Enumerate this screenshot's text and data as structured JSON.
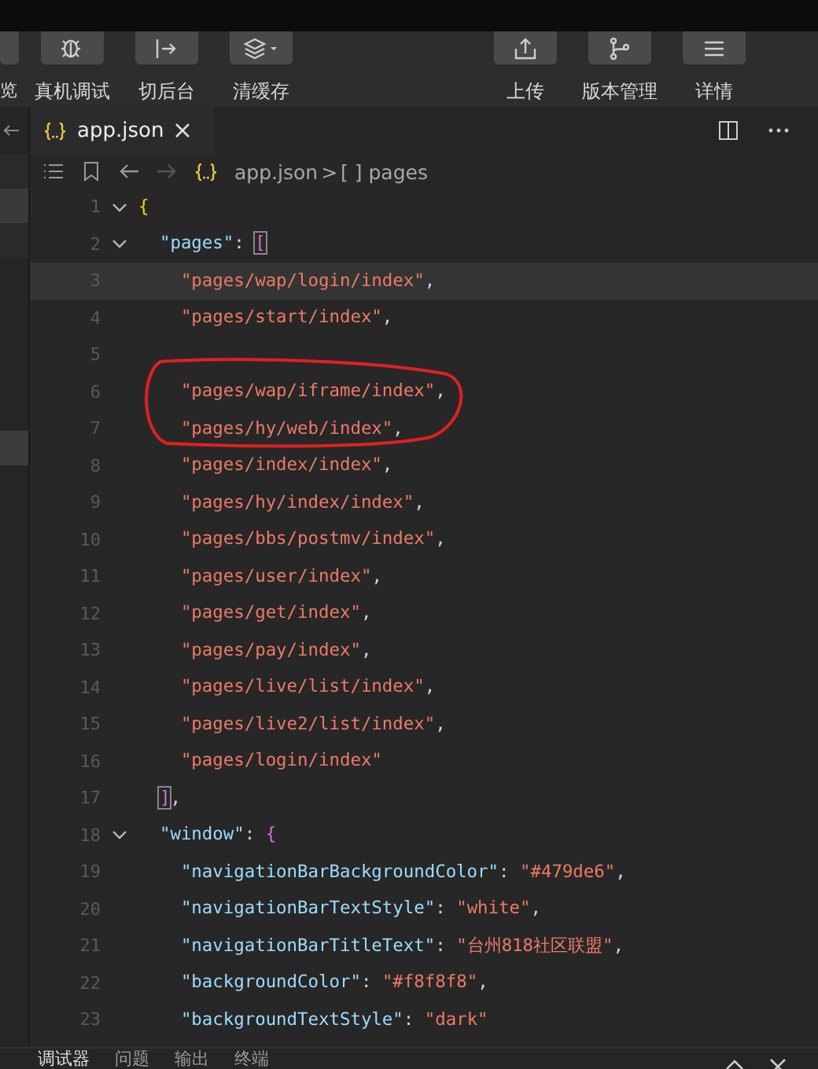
{
  "toolbar": {
    "left_buttons": [
      {
        "kind": "partial",
        "label": "览"
      },
      {
        "kind": "bug",
        "label": "真机调试"
      },
      {
        "kind": "exit",
        "label": "切后台"
      },
      {
        "kind": "layers",
        "label": "清缓存"
      }
    ],
    "right_buttons": [
      {
        "kind": "upload",
        "label": "上传"
      },
      {
        "kind": "branch",
        "label": "版本管理"
      },
      {
        "kind": "menu",
        "label": "详情"
      }
    ]
  },
  "tabs": [
    {
      "label": "app.json",
      "selected": true
    }
  ],
  "breadcrumb": {
    "file": "app.json",
    "separator": ">",
    "symbol": "[ ] pages"
  },
  "code_lines": [
    {
      "number": "1",
      "fold": true,
      "tokens": [
        {
          "kind": "brace1",
          "text": "{"
        }
      ],
      "children": [
        {
          "number": "2",
          "fold": true,
          "tokens": [
            {
              "kind": "key",
              "text": "\"pages\""
            },
            {
              "kind": "punct",
              "text": ": "
            },
            {
              "kind": "match",
              "text": "["
            }
          ],
          "children": [
            {
              "number": "3",
              "current": true,
              "tokens": [
                {
                  "kind": "str",
                  "text": "\"pages/wap/login/index\""
                },
                {
                  "kind": "punct",
                  "text": ","
                }
              ]
            },
            {
              "number": "4",
              "tokens": [
                {
                  "kind": "str",
                  "text": "\"pages/start/index\""
                },
                {
                  "kind": "punct",
                  "text": ","
                }
              ]
            },
            {
              "number": "5"
            },
            {
              "number": "6",
              "tokens": [
                {
                  "kind": "str",
                  "text": "\"pages/wap/iframe/index\""
                },
                {
                  "kind": "punct",
                  "text": ","
                }
              ]
            },
            {
              "number": "7",
              "tokens": [
                {
                  "kind": "str",
                  "text": "\"pages/hy/web/index\""
                },
                {
                  "kind": "punct",
                  "text": ","
                }
              ]
            },
            {
              "number": "8",
              "tokens": [
                {
                  "kind": "str",
                  "text": "\"pages/index/index\""
                },
                {
                  "kind": "punct",
                  "text": ","
                }
              ]
            },
            {
              "number": "9",
              "tokens": [
                {
                  "kind": "str",
                  "text": "\"pages/hy/index/index\""
                },
                {
                  "kind": "punct",
                  "text": ","
                }
              ]
            },
            {
              "number": "10",
              "tokens": [
                {
                  "kind": "str",
                  "text": "\"pages/bbs/postmv/index\""
                },
                {
                  "kind": "punct",
                  "text": ","
                }
              ]
            },
            {
              "number": "11",
              "tokens": [
                {
                  "kind": "str",
                  "text": "\"pages/user/index\""
                },
                {
                  "kind": "punct",
                  "text": ","
                }
              ]
            },
            {
              "number": "12",
              "tokens": [
                {
                  "kind": "str",
                  "text": "\"pages/get/index\""
                },
                {
                  "kind": "punct",
                  "text": ","
                }
              ]
            },
            {
              "number": "13",
              "tokens": [
                {
                  "kind": "str",
                  "text": "\"pages/pay/index\""
                },
                {
                  "kind": "punct",
                  "text": ","
                }
              ]
            },
            {
              "number": "14",
              "tokens": [
                {
                  "kind": "str",
                  "text": "\"pages/live/list/index\""
                },
                {
                  "kind": "punct",
                  "text": ","
                }
              ]
            },
            {
              "number": "15",
              "tokens": [
                {
                  "kind": "str",
                  "text": "\"pages/live2/list/index\""
                },
                {
                  "kind": "punct",
                  "text": ","
                }
              ]
            },
            {
              "number": "16",
              "tokens": [
                {
                  "kind": "str",
                  "text": "\"pages/login/index\""
                }
              ]
            }
          ]
        },
        {
          "number": "17",
          "tokens": [
            {
              "kind": "match",
              "text": "]"
            },
            {
              "kind": "punct",
              "text": ","
            }
          ]
        },
        {
          "number": "18",
          "fold": true,
          "tokens": [
            {
              "kind": "key",
              "text": "\"window\""
            },
            {
              "kind": "punct",
              "text": ": "
            },
            {
              "kind": "brace2",
              "text": "{"
            }
          ],
          "children": [
            {
              "number": "19",
              "tokens": [
                {
                  "kind": "key",
                  "text": "\"navigationBarBackgroundColor\""
                },
                {
                  "kind": "punct",
                  "text": ": "
                },
                {
                  "kind": "str",
                  "text": "\"#479de6\""
                },
                {
                  "kind": "punct",
                  "text": ","
                }
              ]
            },
            {
              "number": "20",
              "tokens": [
                {
                  "kind": "key",
                  "text": "\"navigationBarTextStyle\""
                },
                {
                  "kind": "punct",
                  "text": ": "
                },
                {
                  "kind": "str",
                  "text": "\"white\""
                },
                {
                  "kind": "punct",
                  "text": ","
                }
              ]
            },
            {
              "number": "21",
              "tokens": [
                {
                  "kind": "key",
                  "text": "\"navigationBarTitleText\""
                },
                {
                  "kind": "punct",
                  "text": ": "
                },
                {
                  "kind": "str",
                  "text": "\"台州818社区联盟\""
                },
                {
                  "kind": "punct",
                  "text": ","
                }
              ]
            },
            {
              "number": "22",
              "tokens": [
                {
                  "kind": "key",
                  "text": "\"backgroundColor\""
                },
                {
                  "kind": "punct",
                  "text": ": "
                },
                {
                  "kind": "str",
                  "text": "\"#f8f8f8\""
                },
                {
                  "kind": "punct",
                  "text": ","
                }
              ]
            },
            {
              "number": "23",
              "tokens": [
                {
                  "kind": "key",
                  "text": "\"backgroundTextStyle\""
                },
                {
                  "kind": "punct",
                  "text": ": "
                },
                {
                  "kind": "str",
                  "text": "\"dark\""
                }
              ]
            }
          ]
        }
      ]
    }
  ],
  "annotation": {
    "kind": "ellipse",
    "color": "#e02020"
  },
  "bottom_panel": {
    "tabs": [
      {
        "label": "调试器",
        "selected": true
      },
      {
        "label": "问题",
        "selected": false
      },
      {
        "label": "输出",
        "selected": false
      },
      {
        "label": "终端",
        "selected": false
      }
    ]
  }
}
